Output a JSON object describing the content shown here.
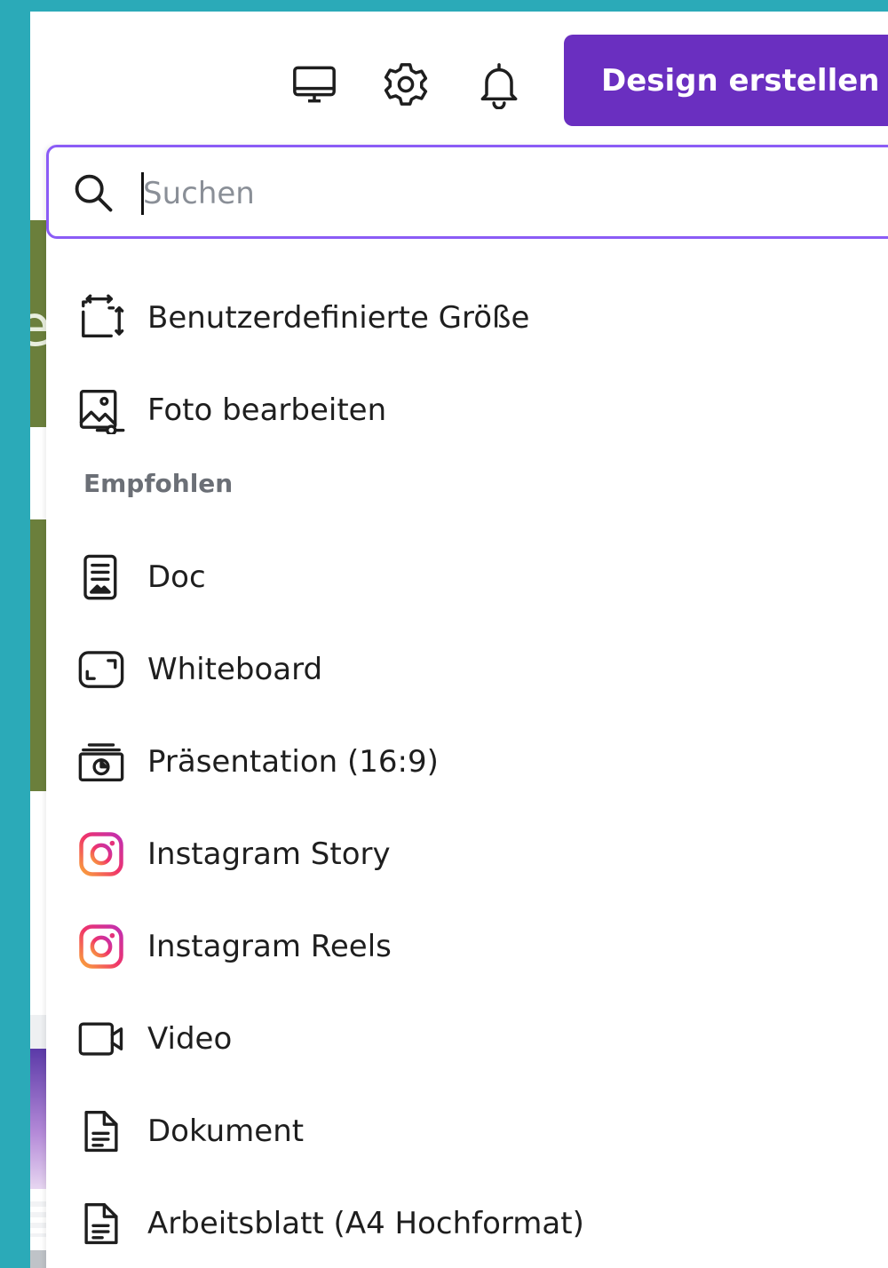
{
  "header": {
    "create_button_label": "Design erstellen",
    "icons": [
      "monitor-icon",
      "gear-icon",
      "bell-icon"
    ],
    "accent_color": "#6a2fc0"
  },
  "search": {
    "placeholder": "Suchen",
    "value": "",
    "focus_border_color": "#8b5cf6"
  },
  "quick_actions": [
    {
      "label": "Benutzerdefinierte Größe",
      "icon": "custom-size-icon"
    },
    {
      "label": "Foto bearbeiten",
      "icon": "photo-edit-icon"
    }
  ],
  "recommended": {
    "heading": "Empfohlen",
    "items": [
      {
        "label": "Doc",
        "icon": "doc-icon"
      },
      {
        "label": "Whiteboard",
        "icon": "whiteboard-icon"
      },
      {
        "label": "Präsentation (16:9)",
        "icon": "presentation-icon"
      },
      {
        "label": "Instagram Story",
        "icon": "instagram-icon"
      },
      {
        "label": "Instagram Reels",
        "icon": "instagram-icon"
      },
      {
        "label": "Video",
        "icon": "video-icon"
      },
      {
        "label": "Dokument",
        "icon": "document-icon"
      },
      {
        "label": "Arbeitsblatt (A4 Hochformat)",
        "icon": "document-icon"
      }
    ]
  }
}
